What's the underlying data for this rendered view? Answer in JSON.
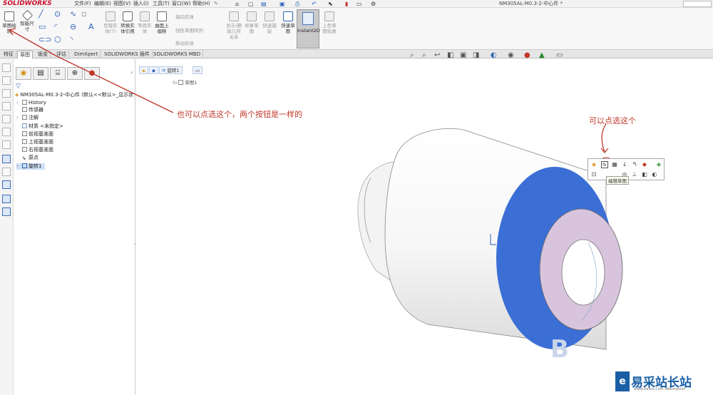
{
  "app": {
    "logo": "SOLIDWORKS",
    "doc_title": "NM305AL-M0.3-2-中心件 *"
  },
  "menu": {
    "items": [
      "文件(F)",
      "编辑(E)",
      "视图(V)",
      "插入(I)",
      "工具(T)",
      "窗口(W)",
      "帮助(H)"
    ]
  },
  "ribbon": {
    "sketch_btn": "草图绘制",
    "smart_dim_btn": "智能尺寸",
    "trim_btn": "剪裁实体(T)",
    "convert_btn": "转换实体引用",
    "offset_btn": "等距实体",
    "surface_offset_btn": "曲面上偏移",
    "mirror": "镜向实体",
    "linear_pattern": "线性草图阵列",
    "move": "移动实体",
    "show_hide": "显示/删除几何关系",
    "repair": "修复草图",
    "rapid": "快速捕捉",
    "quick_sketch": "快速草图",
    "instant2d": "Instant2D",
    "shaded_sketch": "上色草图轮廓"
  },
  "tabs": [
    "特征",
    "草图",
    "钣金",
    "评估",
    "DimXpert",
    "SOLIDWORKS 插件",
    "SOLIDWORKS MBD"
  ],
  "active_tab": "草图",
  "tree": {
    "root": "NM305AL-M0.3-2-中心件 (默认<<默认>_显示状",
    "items": [
      {
        "label": "History",
        "expandable": true
      },
      {
        "label": "传感器",
        "expandable": false
      },
      {
        "label": "注解",
        "expandable": true
      },
      {
        "label": "材质 <未指定>",
        "expandable": false
      },
      {
        "label": "前视基准面",
        "expandable": false
      },
      {
        "label": "上视基准面",
        "expandable": false
      },
      {
        "label": "右视基准面",
        "expandable": false
      },
      {
        "label": "原点",
        "expandable": false
      },
      {
        "label": "旋转1",
        "expandable": true,
        "selected": true
      }
    ]
  },
  "breadcrumb": {
    "segment": "旋转1",
    "sub": "草图1"
  },
  "annotations": {
    "left_note": "也可以点选这个，两个按钮是一样的",
    "right_note": "可以点选这个"
  },
  "tooltip": "编辑草图",
  "watermark": {
    "text": "易采站长站",
    "sub": "Www.Easck.Com Webmaster",
    "logo": "e"
  },
  "colors": {
    "accent": "#2a62b8",
    "annotation": "#c0392b",
    "face_blue": "#3b6fd6",
    "inner_face": "#d8c4dc"
  }
}
